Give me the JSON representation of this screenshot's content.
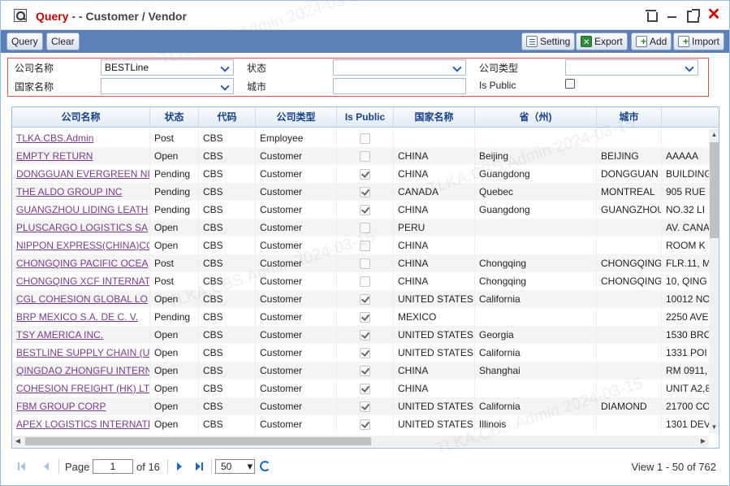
{
  "window": {
    "title_prefix": "Query",
    "title_rest": " - - Customer / Vendor"
  },
  "toolbar": {
    "query_label": "Query",
    "clear_label": "Clear",
    "setting_label": "Setting",
    "export_label": "Export",
    "add_label": "Add",
    "import_label": "Import"
  },
  "filters": {
    "company_name_label": "公司名称",
    "company_name_value": "BESTLine",
    "status_label": "状态",
    "status_value": "",
    "company_type_label": "公司类型",
    "company_type_value": "",
    "country_label": "国家名称",
    "country_value": "",
    "city_label": "城市",
    "city_value": "",
    "is_public_label": "Is Public",
    "is_public_checked": false
  },
  "grid": {
    "columns": [
      "公司名称",
      "状态",
      "代码",
      "公司类型",
      "Is Public",
      "国家名称",
      "省（州)",
      "城市",
      ""
    ],
    "rows": [
      {
        "name": "TLKA.CBS.Admin",
        "status": "Post",
        "code": "CBS",
        "type": "Employee",
        "public": false,
        "country": "",
        "province": "",
        "city": "",
        "address": ""
      },
      {
        "name": "EMPTY RETURN",
        "status": "Open",
        "code": "CBS",
        "type": "Customer",
        "public": false,
        "country": "CHINA",
        "province": "Beijing",
        "city": "BEIJING",
        "address": "AAAAA"
      },
      {
        "name": "DONGGUAN EVERGREEN NI",
        "status": "Pending",
        "code": "CBS",
        "type": "Customer",
        "public": true,
        "country": "CHINA",
        "province": "Guangdong",
        "city": "DONGGUAN",
        "address": "BUILDING"
      },
      {
        "name": "THE ALDO GROUP INC",
        "status": "Pending",
        "code": "CBS",
        "type": "Customer",
        "public": true,
        "country": "CANADA",
        "province": "Quebec",
        "city": "MONTREAL",
        "address": "905 RUE"
      },
      {
        "name": "GUANGZHOU LIDING LEATH",
        "status": "Pending",
        "code": "CBS",
        "type": "Customer",
        "public": true,
        "country": "CHINA",
        "province": "Guangdong",
        "city": "GUANGZHOU",
        "address": "NO.32 LI"
      },
      {
        "name": "PLUSCARGO LOGISTICS SA",
        "status": "Open",
        "code": "CBS",
        "type": "Customer",
        "public": false,
        "country": "PERU",
        "province": "",
        "city": "",
        "address": "AV. CANA"
      },
      {
        "name": "NIPPON EXPRESS(CHINA)CO",
        "status": "Open",
        "code": "CBS",
        "type": "Customer",
        "public": false,
        "country": "CHINA",
        "province": "",
        "city": "",
        "address": "ROOM K"
      },
      {
        "name": "CHONGQING PACIFIC OCEA",
        "status": "Post",
        "code": "CBS",
        "type": "Customer",
        "public": false,
        "country": "CHINA",
        "province": "Chongqing",
        "city": "CHONGQING",
        "address": "FLR.11, M"
      },
      {
        "name": "CHONGQING XCF INTERNAT",
        "status": "Post",
        "code": "CBS",
        "type": "Customer",
        "public": false,
        "country": "CHINA",
        "province": "Chongqing",
        "city": "CHONGQING",
        "address": "10, QING"
      },
      {
        "name": "CGL COHESION GLOBAL LO",
        "status": "Open",
        "code": "CBS",
        "type": "Customer",
        "public": true,
        "country": "UNITED STATES",
        "province": "California",
        "city": "",
        "address": "10012 NO"
      },
      {
        "name": "BRP MEXICO S.A. DE C. V.",
        "status": "Pending",
        "code": "CBS",
        "type": "Customer",
        "public": true,
        "country": "MEXICO",
        "province": "",
        "city": "",
        "address": "2250 AVE"
      },
      {
        "name": "TSY AMERICA INC.",
        "status": "Open",
        "code": "CBS",
        "type": "Customer",
        "public": true,
        "country": "UNITED STATES",
        "province": "Georgia",
        "city": "",
        "address": "1530 BRO"
      },
      {
        "name": "BESTLINE SUPPLY CHAIN (U",
        "status": "Open",
        "code": "CBS",
        "type": "Customer",
        "public": true,
        "country": "UNITED STATES",
        "province": "California",
        "city": "",
        "address": "1331 POI"
      },
      {
        "name": "QINGDAO ZHONGFU INTERN",
        "status": "Open",
        "code": "CBS",
        "type": "Customer",
        "public": true,
        "country": "CHINA",
        "province": "Shanghai",
        "city": "",
        "address": "RM 0911,"
      },
      {
        "name": "COHESION FREIGHT (HK) LT",
        "status": "Open",
        "code": "CBS",
        "type": "Customer",
        "public": true,
        "country": "CHINA",
        "province": "",
        "city": "",
        "address": "UNIT A2,8"
      },
      {
        "name": "FBM GROUP CORP",
        "status": "Open",
        "code": "CBS",
        "type": "Customer",
        "public": true,
        "country": "UNITED STATES",
        "province": "California",
        "city": "DIAMOND",
        "address": "21700 CO"
      },
      {
        "name": "APEX LOGISTICS INTERNATI",
        "status": "Open",
        "code": "CBS",
        "type": "Customer",
        "public": true,
        "country": "UNITED STATES",
        "province": "Illinois",
        "city": "",
        "address": "1301 DEV"
      }
    ]
  },
  "pager": {
    "page_label": "Page",
    "page_value": "1",
    "of_label": "of 16",
    "page_size": "50",
    "view_text": "View 1 - 50 of 762"
  },
  "watermark": "TLKA.CBS.Admin 2024-03-15"
}
